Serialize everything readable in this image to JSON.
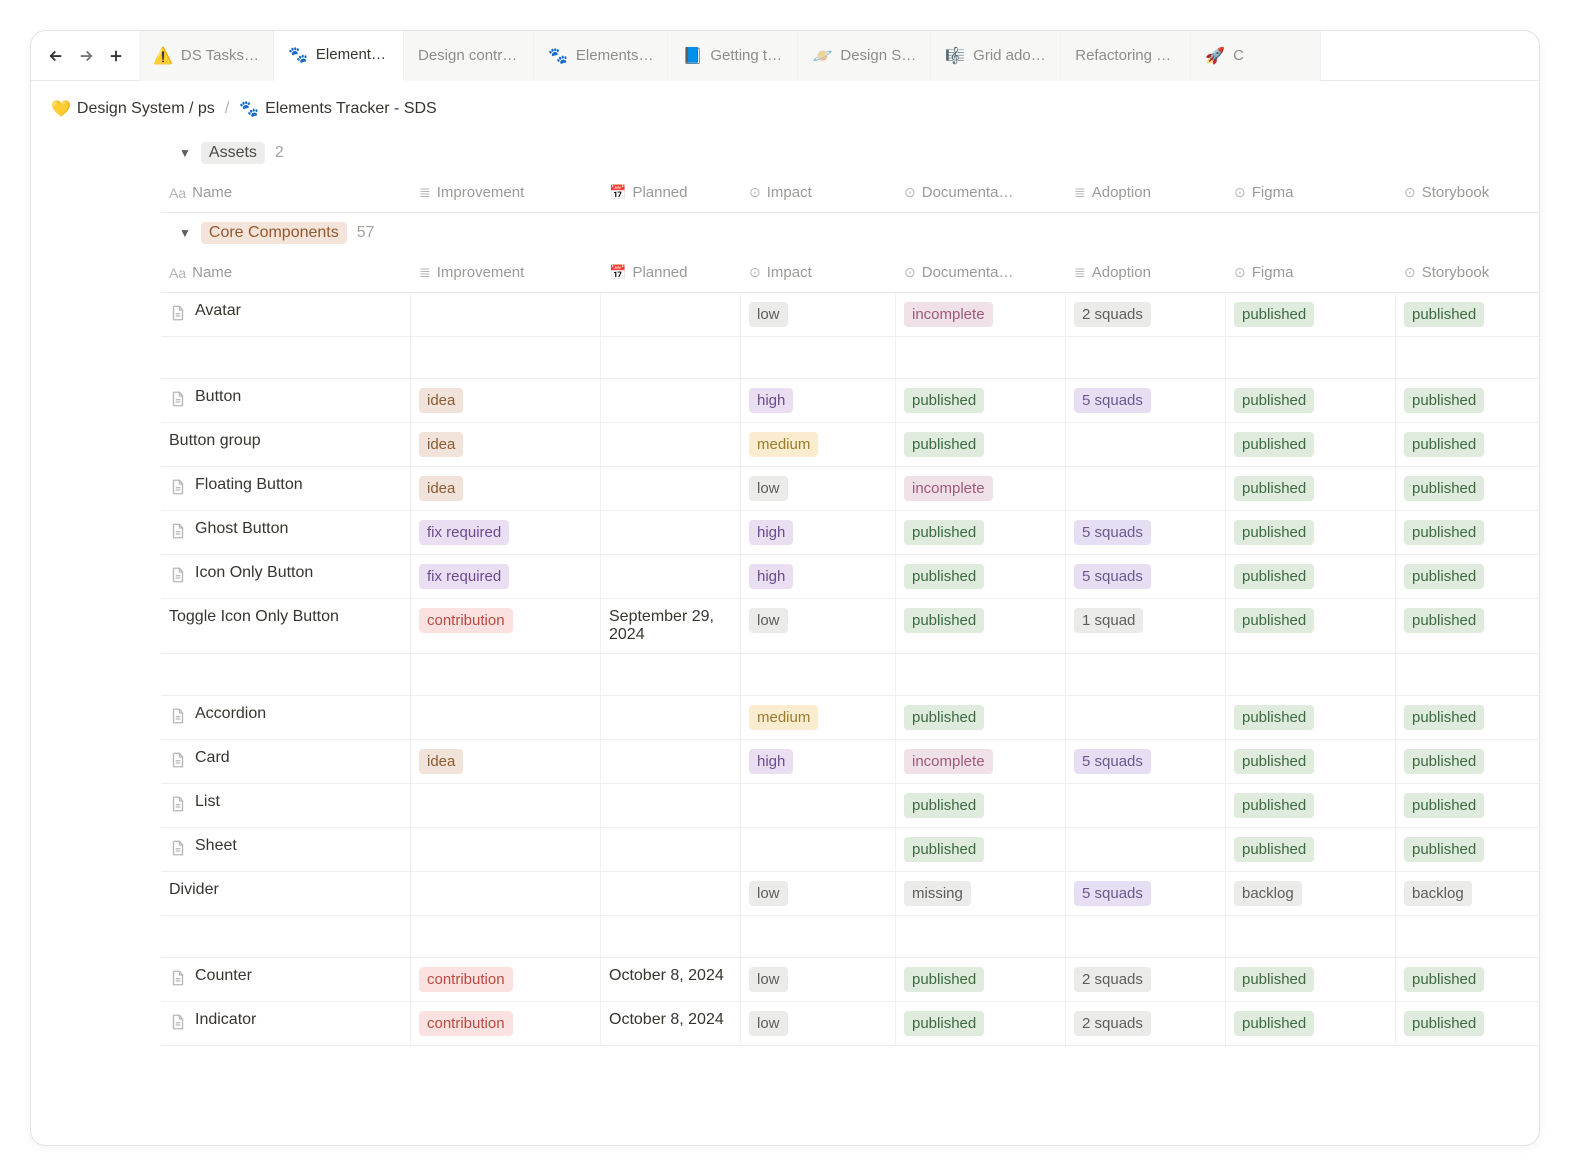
{
  "nav": {
    "back": "←",
    "forward": "→",
    "plus": "+"
  },
  "tabs": [
    {
      "emoji": "⚠️",
      "label": "DS Tasks…"
    },
    {
      "emoji": "🐾",
      "label": "Element…",
      "selected": true
    },
    {
      "emoji": "",
      "label": "Design contr…"
    },
    {
      "emoji": "🐾",
      "label": "Elements…"
    },
    {
      "emoji": "📘",
      "label": "Getting t…"
    },
    {
      "emoji": "🪐",
      "label": "Design S…"
    },
    {
      "emoji": "🎼",
      "label": "Grid ado…"
    },
    {
      "emoji": "",
      "label": "Refactoring …"
    },
    {
      "emoji": "🚀",
      "label": "C"
    }
  ],
  "breadcrumb": {
    "root_emoji": "💛",
    "root": "Design System / ps",
    "sep": "/",
    "page_emoji": "🐾",
    "page": "Elements Tracker - SDS"
  },
  "columns": [
    {
      "icon": "Aa",
      "label": "Name"
    },
    {
      "icon": "≣",
      "label": "Improvement"
    },
    {
      "icon": "📅",
      "label": "Planned"
    },
    {
      "icon": "⊙",
      "label": "Impact"
    },
    {
      "icon": "⊙",
      "label": "Documenta…"
    },
    {
      "icon": "≣",
      "label": "Adoption"
    },
    {
      "icon": "⊙",
      "label": "Figma"
    },
    {
      "icon": "⊙",
      "label": "Storybook"
    }
  ],
  "groups": [
    {
      "name": "Assets",
      "count": "2",
      "class": "assets",
      "rows": []
    },
    {
      "name": "Core Components",
      "count": "57",
      "class": "core",
      "rows": [
        {
          "name": "Avatar",
          "icon": true,
          "impact": "low",
          "documentation": "incomplete",
          "adoption": "2 squads",
          "figma": "published",
          "storybook": "published"
        },
        {
          "gap": true
        },
        {
          "name": "Button",
          "icon": true,
          "improvement": "idea",
          "impact": "high",
          "documentation": "published",
          "adoption": "5 squads",
          "figma": "published",
          "storybook": "published"
        },
        {
          "name": "Button group",
          "icon": false,
          "improvement": "idea",
          "impact": "medium",
          "documentation": "published",
          "figma": "published",
          "storybook": "published"
        },
        {
          "name": "Floating Button",
          "icon": true,
          "improvement": "idea",
          "impact": "low",
          "documentation": "incomplete",
          "figma": "published",
          "storybook": "published"
        },
        {
          "name": "Ghost Button",
          "icon": true,
          "improvement": "fix required",
          "impact": "high",
          "documentation": "published",
          "adoption": "5 squads",
          "figma": "published",
          "storybook": "published"
        },
        {
          "name": "Icon Only Button",
          "icon": true,
          "improvement": "fix required",
          "impact": "high",
          "documentation": "published",
          "adoption": "5 squads",
          "figma": "published",
          "storybook": "published"
        },
        {
          "name": "Toggle Icon Only Button",
          "icon": false,
          "improvement": "contribution",
          "planned": "September 29, 2024",
          "impact": "low",
          "documentation": "published",
          "adoption": "1 squad",
          "figma": "published",
          "storybook": "published"
        },
        {
          "gap": true
        },
        {
          "name": "Accordion",
          "icon": true,
          "impact": "medium",
          "documentation": "published",
          "figma": "published",
          "storybook": "published"
        },
        {
          "name": "Card",
          "icon": true,
          "improvement": "idea",
          "impact": "high",
          "documentation": "incomplete",
          "adoption": "5 squads",
          "figma": "published",
          "storybook": "published"
        },
        {
          "name": "List",
          "icon": true,
          "documentation": "published",
          "figma": "published",
          "storybook": "published"
        },
        {
          "name": "Sheet",
          "icon": true,
          "documentation": "published",
          "figma": "published",
          "storybook": "published"
        },
        {
          "name": "Divider",
          "icon": false,
          "impact": "low",
          "documentation": "missing",
          "adoption": "5 squads",
          "figma": "backlog",
          "storybook": "backlog"
        },
        {
          "gap": true
        },
        {
          "name": "Counter",
          "icon": true,
          "improvement": "contribution",
          "planned": "October 8, 2024",
          "impact": "low",
          "documentation": "published",
          "adoption": "2 squads",
          "figma": "published",
          "storybook": "published"
        },
        {
          "name": "Indicator",
          "icon": true,
          "improvement": "contribution",
          "planned": "October 8, 2024",
          "impact": "low",
          "documentation": "published",
          "adoption": "2 squads",
          "figma": "published",
          "storybook": "published"
        }
      ]
    }
  ]
}
